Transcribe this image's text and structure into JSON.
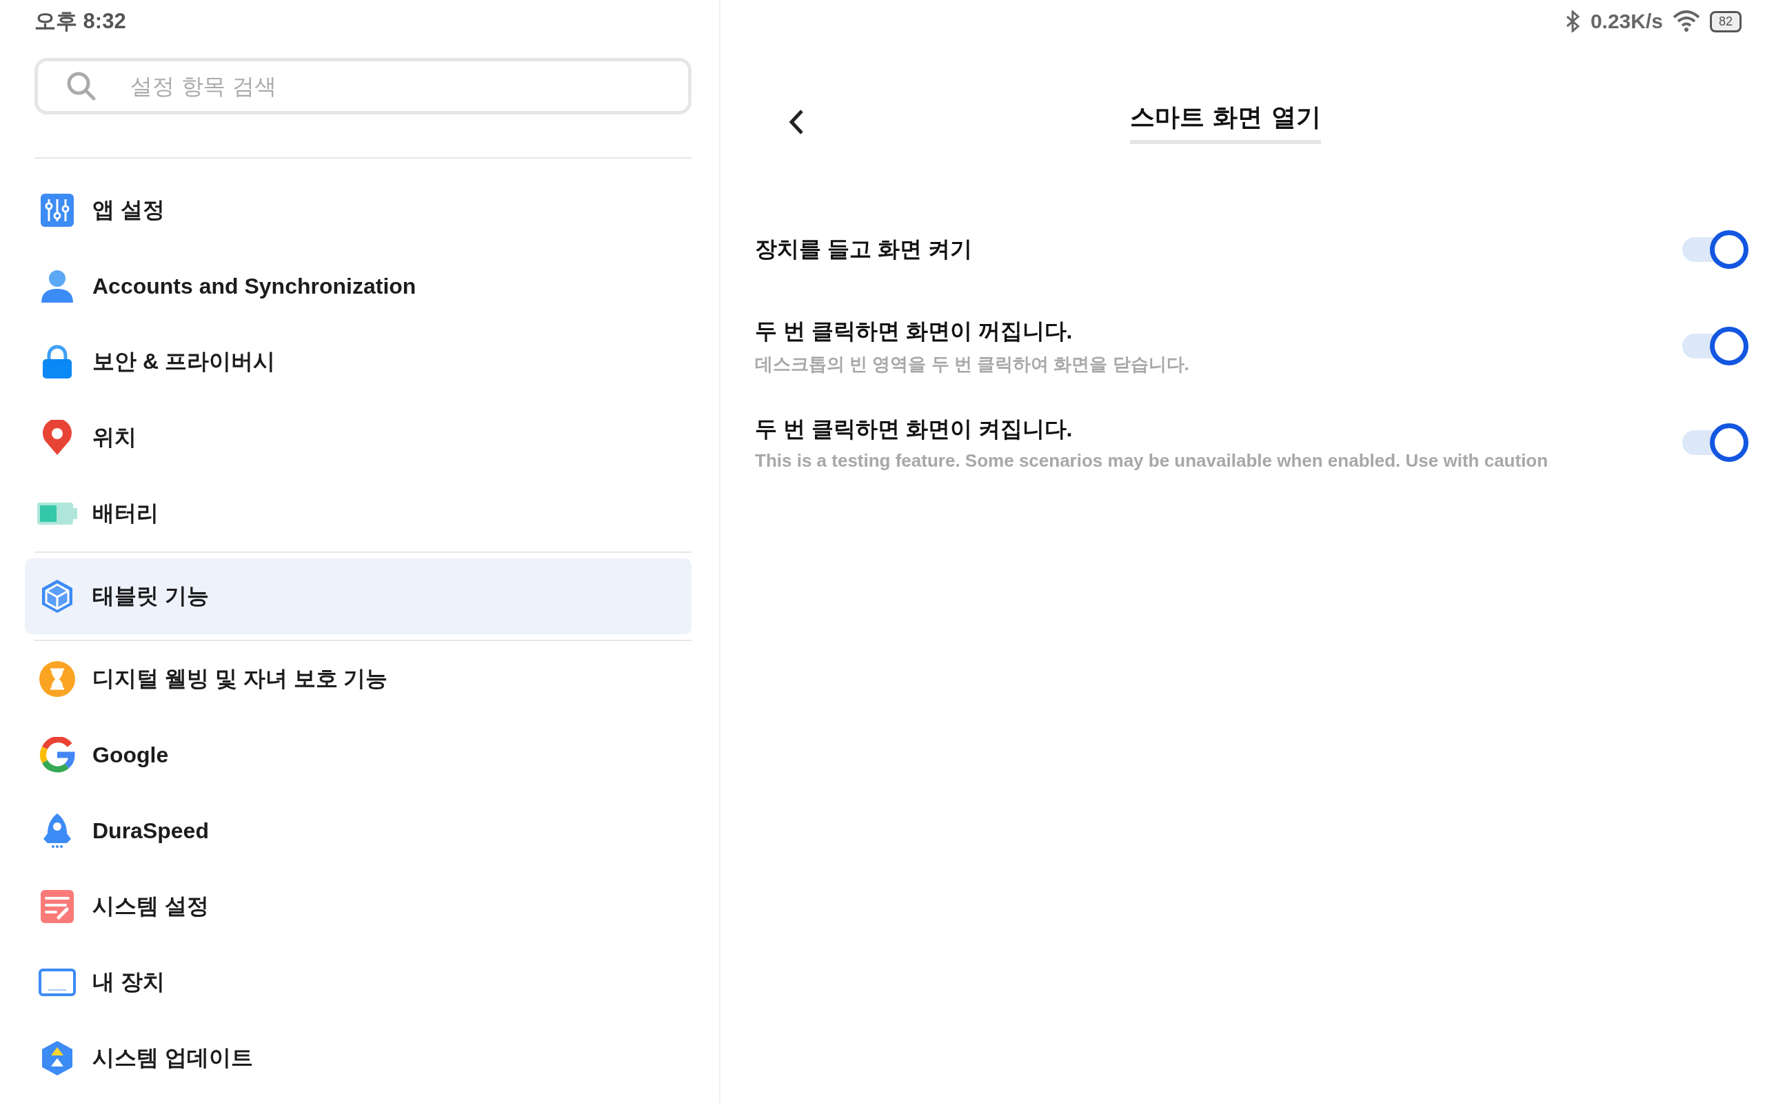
{
  "status_bar": {
    "time": "오후 8:32",
    "network_speed": "0.23K/s",
    "battery": "82"
  },
  "sidebar": {
    "search": {
      "placeholder": "설정 항목 검색"
    },
    "sections": [
      {
        "items": [
          {
            "label": "앱 설정",
            "selected": false
          },
          {
            "label": "Accounts and Synchronization",
            "selected": false
          },
          {
            "label": "보안 & 프라이버시",
            "selected": false
          },
          {
            "label": "위치",
            "selected": false
          },
          {
            "label": "배터리",
            "selected": false
          }
        ]
      },
      {
        "items": [
          {
            "label": "태블릿 기능",
            "selected": true
          }
        ]
      },
      {
        "items": [
          {
            "label": "디지털 웰빙 및 자녀 보호 기능",
            "selected": false
          },
          {
            "label": "Google",
            "selected": false
          },
          {
            "label": "DuraSpeed",
            "selected": false
          },
          {
            "label": "시스템 설정",
            "selected": false
          },
          {
            "label": "내 장치",
            "selected": false
          },
          {
            "label": "시스템 업데이트",
            "selected": false
          }
        ]
      }
    ]
  },
  "detail": {
    "title": "스마트 화면 열기",
    "settings": [
      {
        "title": "장치를 들고 화면 켜기",
        "on": true
      },
      {
        "title": "두 번 클릭하면 화면이 꺼집니다.",
        "subtitle": "데스크톱의 빈 영역을 두 번 클릭하여 화면을 닫습니다.",
        "on": true
      },
      {
        "title": "두 번 클릭하면 화면이 켜집니다.",
        "subtitle": "This is a testing feature. Some scenarios may be unavailable when enabled. Use with caution",
        "on": true
      }
    ]
  }
}
